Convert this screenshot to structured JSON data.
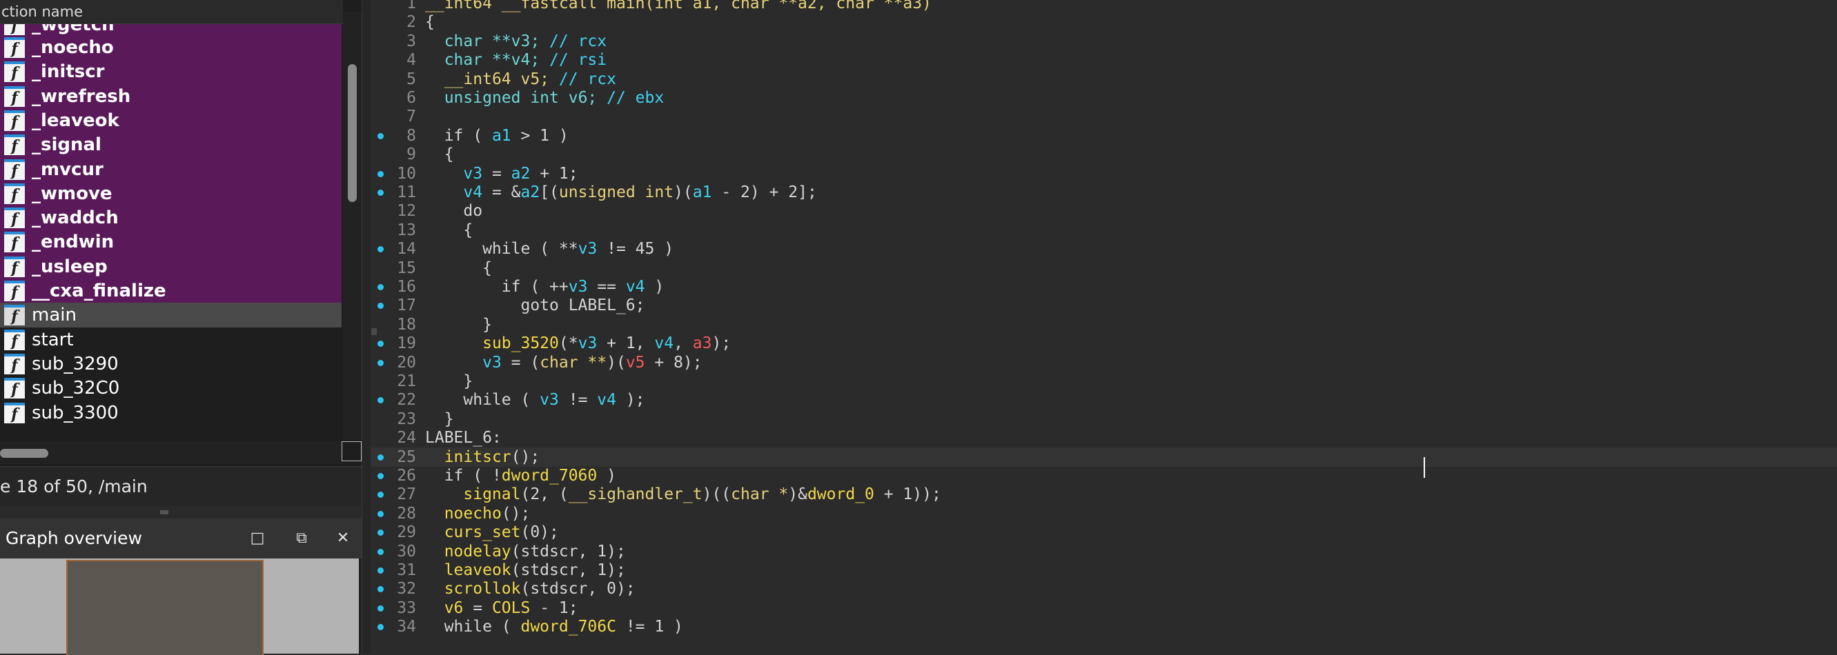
{
  "function_list": {
    "header": "ction name",
    "items": [
      {
        "name": "_wgetch",
        "kind": "library",
        "partial": true
      },
      {
        "name": "_noecho",
        "kind": "library"
      },
      {
        "name": "_initscr",
        "kind": "library"
      },
      {
        "name": "_wrefresh",
        "kind": "library"
      },
      {
        "name": "_leaveok",
        "kind": "library"
      },
      {
        "name": "_signal",
        "kind": "library"
      },
      {
        "name": "_mvcur",
        "kind": "library"
      },
      {
        "name": "_wmove",
        "kind": "library"
      },
      {
        "name": "_waddch",
        "kind": "library"
      },
      {
        "name": "_endwin",
        "kind": "library"
      },
      {
        "name": "_usleep",
        "kind": "library"
      },
      {
        "name": "__cxa_finalize",
        "kind": "library"
      },
      {
        "name": "main",
        "kind": "selected"
      },
      {
        "name": "start",
        "kind": "regular"
      },
      {
        "name": "sub_3290",
        "kind": "regular"
      },
      {
        "name": "sub_32C0",
        "kind": "regular"
      },
      {
        "name": "sub_3300",
        "kind": "regular"
      }
    ],
    "icon": "function-icon",
    "icon_glyph": "f",
    "library_color": "#5a1a5a"
  },
  "status": "e 18 of 50, /main",
  "graph_overview": {
    "title": "Graph overview",
    "buttons": [
      {
        "name": "maximize-icon",
        "glyph": "□"
      },
      {
        "name": "restore-icon",
        "glyph": "⧉"
      },
      {
        "name": "close-icon",
        "glyph": "✕"
      }
    ]
  },
  "code": {
    "current_line": 25,
    "lines": [
      {
        "n": "1",
        "bp": false,
        "tokens": [
          [
            "kw",
            "__int64 __fastcall main(int a1, char **a2, char **a3)"
          ]
        ]
      },
      {
        "n": "2",
        "bp": false,
        "tokens": [
          [
            "t",
            "{"
          ]
        ]
      },
      {
        "n": "3",
        "bp": false,
        "tokens": [
          [
            "t",
            "  "
          ],
          [
            "ty",
            "char **v3; "
          ],
          [
            "cm",
            "// rcx"
          ]
        ]
      },
      {
        "n": "4",
        "bp": false,
        "tokens": [
          [
            "t",
            "  "
          ],
          [
            "ty",
            "char **v4; "
          ],
          [
            "cm",
            "// rsi"
          ]
        ]
      },
      {
        "n": "5",
        "bp": false,
        "tokens": [
          [
            "t",
            "  "
          ],
          [
            "kw",
            "__int64 v5; "
          ],
          [
            "cm",
            "// rcx"
          ]
        ]
      },
      {
        "n": "6",
        "bp": false,
        "tokens": [
          [
            "t",
            "  "
          ],
          [
            "ty",
            "unsigned int v6; "
          ],
          [
            "cm",
            "// ebx"
          ]
        ]
      },
      {
        "n": "7",
        "bp": false,
        "tokens": [
          [
            "t",
            ""
          ]
        ]
      },
      {
        "n": "8",
        "bp": true,
        "tokens": [
          [
            "t",
            "  if ( "
          ],
          [
            "var",
            "a1"
          ],
          [
            "t",
            " > 1 )"
          ]
        ]
      },
      {
        "n": "9",
        "bp": false,
        "tokens": [
          [
            "t",
            "  {"
          ]
        ]
      },
      {
        "n": "10",
        "bp": true,
        "tokens": [
          [
            "t",
            "    "
          ],
          [
            "var",
            "v3"
          ],
          [
            "t",
            " = "
          ],
          [
            "var",
            "a2"
          ],
          [
            "t",
            " + 1;"
          ]
        ]
      },
      {
        "n": "11",
        "bp": true,
        "tokens": [
          [
            "t",
            "    "
          ],
          [
            "var",
            "v4"
          ],
          [
            "t",
            " = &"
          ],
          [
            "var",
            "a2"
          ],
          [
            "t",
            "[("
          ],
          [
            "kw",
            "unsigned int"
          ],
          [
            "t",
            ")("
          ],
          [
            "var",
            "a1"
          ],
          [
            "t",
            " - 2) + 2];"
          ]
        ]
      },
      {
        "n": "12",
        "bp": false,
        "tokens": [
          [
            "t",
            "    do"
          ]
        ]
      },
      {
        "n": "13",
        "bp": false,
        "tokens": [
          [
            "t",
            "    {"
          ]
        ]
      },
      {
        "n": "14",
        "bp": true,
        "tokens": [
          [
            "t",
            "      while ( **"
          ],
          [
            "var",
            "v3"
          ],
          [
            "t",
            " != 45 )"
          ]
        ]
      },
      {
        "n": "15",
        "bp": false,
        "tokens": [
          [
            "t",
            "      {"
          ]
        ]
      },
      {
        "n": "16",
        "bp": true,
        "tokens": [
          [
            "t",
            "        if ( ++"
          ],
          [
            "var",
            "v3"
          ],
          [
            "t",
            " == "
          ],
          [
            "var",
            "v4"
          ],
          [
            "t",
            " )"
          ]
        ]
      },
      {
        "n": "17",
        "bp": true,
        "tokens": [
          [
            "t",
            "          goto LABEL_6;"
          ]
        ]
      },
      {
        "n": "18",
        "bp": false,
        "tokens": [
          [
            "t",
            "      }"
          ]
        ]
      },
      {
        "n": "19",
        "bp": true,
        "tokens": [
          [
            "t",
            "      "
          ],
          [
            "fn",
            "sub_3520"
          ],
          [
            "t",
            "(*"
          ],
          [
            "var",
            "v3"
          ],
          [
            "t",
            " + 1, "
          ],
          [
            "var",
            "v4"
          ],
          [
            "t",
            ", "
          ],
          [
            "arg",
            "a3"
          ],
          [
            "t",
            ");"
          ]
        ]
      },
      {
        "n": "20",
        "bp": true,
        "tokens": [
          [
            "t",
            "      "
          ],
          [
            "var",
            "v3"
          ],
          [
            "t",
            " = ("
          ],
          [
            "kw",
            "char **"
          ],
          [
            "t",
            ")("
          ],
          [
            "arg",
            "v5"
          ],
          [
            "t",
            " + 8);"
          ]
        ]
      },
      {
        "n": "21",
        "bp": false,
        "tokens": [
          [
            "t",
            "    }"
          ]
        ]
      },
      {
        "n": "22",
        "bp": true,
        "tokens": [
          [
            "t",
            "    while ( "
          ],
          [
            "var",
            "v3"
          ],
          [
            "t",
            " != "
          ],
          [
            "var",
            "v4"
          ],
          [
            "t",
            " );"
          ]
        ]
      },
      {
        "n": "23",
        "bp": false,
        "tokens": [
          [
            "t",
            "  }"
          ]
        ]
      },
      {
        "n": "24",
        "bp": false,
        "tokens": [
          [
            "t",
            "LABEL_6:"
          ]
        ]
      },
      {
        "n": "25",
        "bp": true,
        "tokens": [
          [
            "t",
            "  "
          ],
          [
            "fn",
            "initscr"
          ],
          [
            "t",
            "();"
          ]
        ]
      },
      {
        "n": "26",
        "bp": true,
        "tokens": [
          [
            "t",
            "  if ( !"
          ],
          [
            "fn",
            "dword_7060"
          ],
          [
            "t",
            " )"
          ]
        ]
      },
      {
        "n": "27",
        "bp": true,
        "tokens": [
          [
            "t",
            "    "
          ],
          [
            "fn",
            "signal"
          ],
          [
            "t",
            "(2, ("
          ],
          [
            "kw",
            "__sighandler_t"
          ],
          [
            "t",
            ")(("
          ],
          [
            "kw",
            "char *"
          ],
          [
            "t",
            ")&"
          ],
          [
            "fn",
            "dword_0"
          ],
          [
            "t",
            " + 1));"
          ]
        ]
      },
      {
        "n": "28",
        "bp": true,
        "tokens": [
          [
            "t",
            "  "
          ],
          [
            "fn",
            "noecho"
          ],
          [
            "t",
            "();"
          ]
        ]
      },
      {
        "n": "29",
        "bp": true,
        "tokens": [
          [
            "t",
            "  "
          ],
          [
            "fn",
            "curs_set"
          ],
          [
            "t",
            "(0);"
          ]
        ]
      },
      {
        "n": "30",
        "bp": true,
        "tokens": [
          [
            "t",
            "  "
          ],
          [
            "fn",
            "nodelay"
          ],
          [
            "t",
            "(stdscr, 1);"
          ]
        ]
      },
      {
        "n": "31",
        "bp": true,
        "tokens": [
          [
            "t",
            "  "
          ],
          [
            "fn",
            "leaveok"
          ],
          [
            "t",
            "(stdscr, 1);"
          ]
        ]
      },
      {
        "n": "32",
        "bp": true,
        "tokens": [
          [
            "t",
            "  "
          ],
          [
            "fn",
            "scrollok"
          ],
          [
            "t",
            "(stdscr, 0);"
          ]
        ]
      },
      {
        "n": "33",
        "bp": true,
        "tokens": [
          [
            "t",
            "  "
          ],
          [
            "fn",
            "v6"
          ],
          [
            "t",
            " = "
          ],
          [
            "fn",
            "COLS"
          ],
          [
            "t",
            " - 1;"
          ]
        ]
      },
      {
        "n": "34",
        "bp": true,
        "tokens": [
          [
            "t",
            "  while ( "
          ],
          [
            "fn",
            "dword_706C"
          ],
          [
            "t",
            " != 1 )"
          ]
        ]
      }
    ]
  }
}
